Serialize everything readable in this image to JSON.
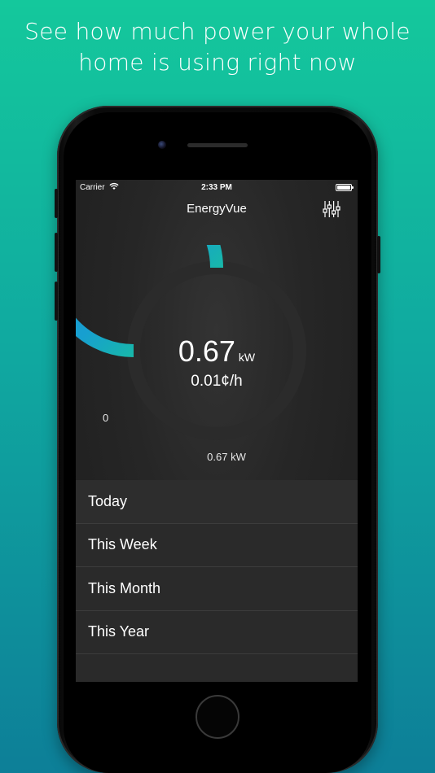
{
  "headline": {
    "line1": "See how much power your whole",
    "line2": "home is using right now"
  },
  "status_bar": {
    "carrier": "Carrier",
    "time": "2:33 PM",
    "wifi_icon": "wifi-icon",
    "battery_icon": "battery-icon"
  },
  "nav": {
    "title": "EnergyVue",
    "settings_icon": "sliders-icon"
  },
  "gauge": {
    "min_label": "0",
    "value": "0.67",
    "unit": "kW",
    "rate": "0.01¢/h",
    "max_value": "0.67",
    "max_unit": "kW",
    "fill_fraction": 0.75,
    "color_start": "#1597d6",
    "color_end": "#18d37f",
    "track_color": "#2b2b2b"
  },
  "periods": [
    {
      "label": "Today"
    },
    {
      "label": "This Week"
    },
    {
      "label": "This Month"
    },
    {
      "label": "This Year"
    }
  ]
}
